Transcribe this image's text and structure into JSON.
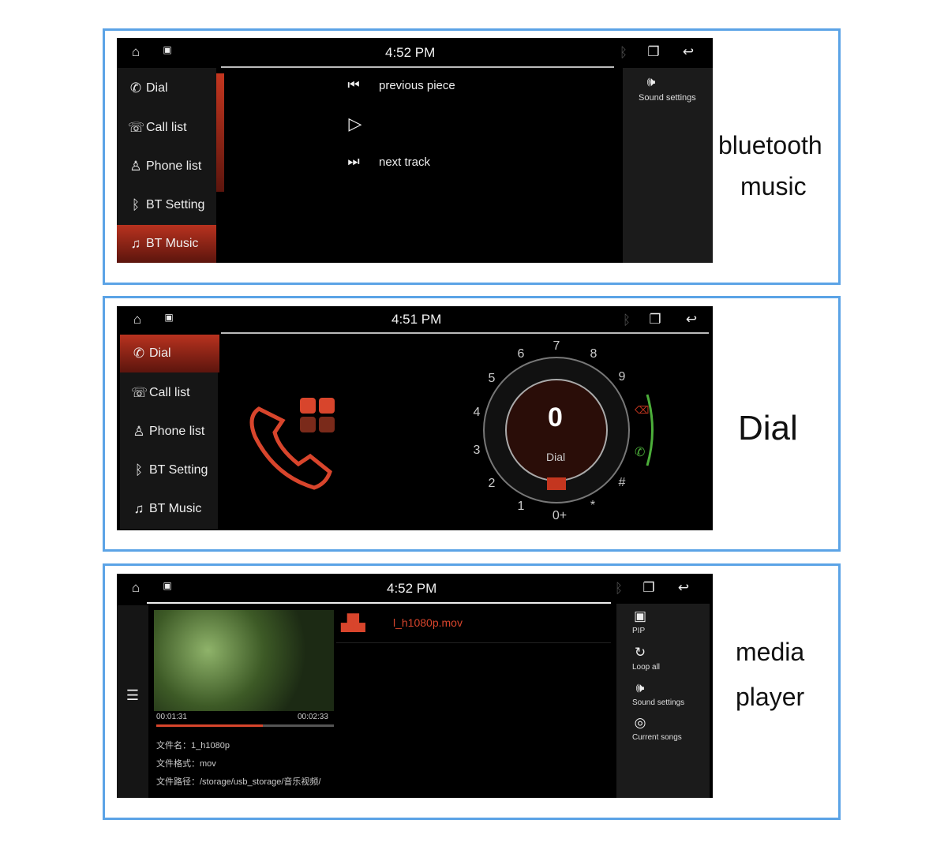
{
  "sidebar_items": [
    "Dial",
    "Call list",
    "Phone list",
    "BT Setting",
    "BT Music"
  ],
  "panel1": {
    "time": "4:52 PM",
    "previous": "previous piece",
    "next": "next track",
    "sound_settings": "Sound settings",
    "label_line1": "bluetooth",
    "label_line2": "music"
  },
  "panel2": {
    "time": "4:51 PM",
    "display_number": "0",
    "dial_label": "Dial",
    "keys": [
      "0+",
      "1",
      "2",
      "3",
      "4",
      "5",
      "6",
      "7",
      "8",
      "9",
      "#",
      "*"
    ],
    "label": "Dial"
  },
  "panel3": {
    "time": "4:52 PM",
    "elapsed": "00:01:31",
    "duration": "00:02:33",
    "progress": 0.6,
    "filename_title": "l_h1080p.mov",
    "file_name": "文件名：1_h1080p",
    "file_format": "文件格式：mov",
    "file_path": "文件路径：/storage/usb_storage/音乐视频/",
    "pip": "PIP",
    "loop": "Loop all",
    "sound_settings": "Sound settings",
    "current_songs": "Current songs",
    "label_line1": "media",
    "label_line2": "player"
  },
  "colors": {
    "accent": "#c4361f",
    "frame": "#5ba3e6",
    "call_green": "#4caf3a"
  }
}
